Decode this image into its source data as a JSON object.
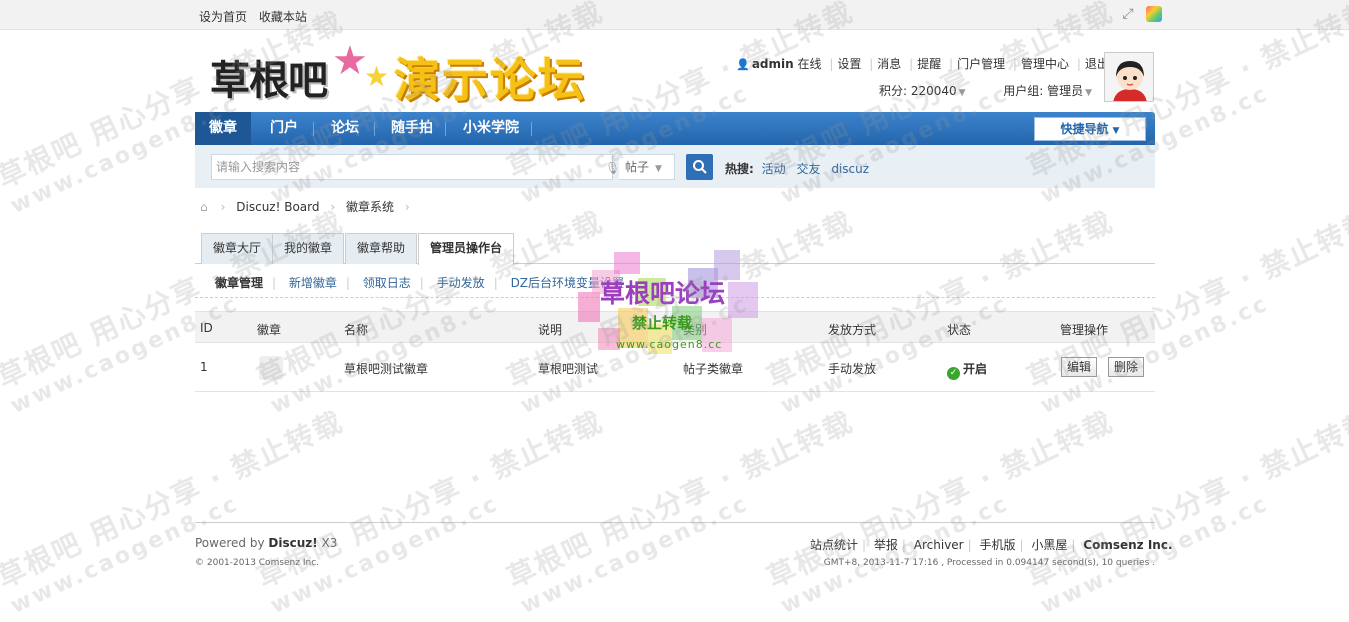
{
  "topbar": {
    "left_links": [
      "设为首页",
      "收藏本站"
    ]
  },
  "logo": {
    "part1": "草根吧",
    "part2": "演示论坛"
  },
  "user_menu": {
    "username": "admin",
    "online": "在线",
    "links": [
      "设置",
      "消息",
      "提醒",
      "门户管理",
      "管理中心",
      "退出"
    ],
    "credits_label": "积分: 220040",
    "group_label": "用户组: 管理员"
  },
  "nav": {
    "items": [
      "徽章",
      "门户",
      "论坛",
      "随手拍",
      "小米学院"
    ],
    "quick_nav": "快捷导航"
  },
  "search": {
    "placeholder": "请输入搜索内容",
    "type": "帖子",
    "hot_label": "热搜:",
    "hot_items": [
      "活动",
      "交友",
      "discuz"
    ]
  },
  "breadcrumb": [
    "Discuz! Board",
    "徽章系统"
  ],
  "tabs": [
    "徽章大厅",
    "我的徽章",
    "徽章帮助",
    "管理员操作台"
  ],
  "subnav": [
    "徽章管理",
    "新增徽章",
    "领取日志",
    "手动发放",
    "DZ后台环境变量设置"
  ],
  "table": {
    "headers": [
      "ID",
      "徽章",
      "名称",
      "说明",
      "类别",
      "发放方式",
      "状态",
      "管理操作"
    ],
    "rows": [
      {
        "id": "1",
        "name": "草根吧测试徽章",
        "desc": "草根吧测试",
        "category": "帖子类徽章",
        "method": "手动发放",
        "status": "开启",
        "edit": "编辑",
        "delete": "删除"
      }
    ]
  },
  "footer": {
    "powered_prefix": "Powered by ",
    "powered_brand": "Discuz!",
    "powered_ver": " X3",
    "copyright": "© 2001-2013 Comsenz Inc.",
    "links": [
      "站点统计",
      "举报",
      "Archiver",
      "手机版",
      "小黑屋"
    ],
    "company": "Comsenz Inc.",
    "debug": "GMT+8, 2013-11-7 17:16 , Processed in 0.094147 second(s), 10 queries ."
  },
  "watermark": {
    "title": "草根吧论坛",
    "subtitle": "禁止转载",
    "url": "www.caogen8.cc",
    "tile_big": "草根吧  用心分享 · 禁止转载",
    "tile_small": "www.caogen8.cc"
  },
  "colors": {
    "nav_blue": "#2365ac",
    "link_blue": "#336699",
    "status_green": "#2e9a00"
  }
}
